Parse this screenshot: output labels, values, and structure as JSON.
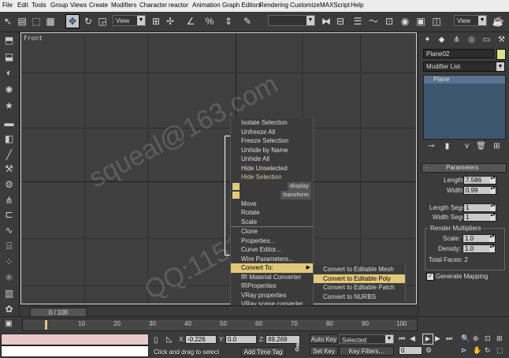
{
  "menubar": {
    "items": [
      "File",
      "Edit",
      "Tools",
      "Group",
      "Views",
      "Create",
      "Modifiers",
      "Character",
      "reactor",
      "Animation",
      "Graph Editors",
      "Rendering",
      "Customize",
      "MAXScript",
      "Help"
    ]
  },
  "toolbar": {
    "view_select_1": "View",
    "view_select_2": "View"
  },
  "viewport": {
    "label": "Front",
    "watermark_1": "squeal@163.com",
    "watermark_2": "QQ:11516493"
  },
  "quad_menu": {
    "top_items": [
      "Isolate Selection",
      "Unfreeze All",
      "Freeze Selection",
      "Unhide by Name",
      "Unhide All",
      "Hide Unselected",
      "Hide Selection"
    ],
    "display_label": "display",
    "transform_label": "transform",
    "transform_items": [
      "Move",
      "Rotate",
      "Scale",
      "Clone",
      "Properties...",
      "Curve Editor...",
      "Wire Parameters...",
      "Convert To:",
      "fR Material Converter",
      "fRProperties",
      "VRay properties",
      "VRay scene converter"
    ]
  },
  "submenu": {
    "items": [
      "Convert to Editable Mesh",
      "Convert to Editable Poly",
      "Convert to Editable Patch",
      "Convert to NURBS"
    ],
    "highlighted": "Convert to Editable Poly"
  },
  "command_panel": {
    "object_name": "Plane02",
    "object_color": "#d8e08a",
    "modifier_list": "Modifier List",
    "stack_item": "Plane",
    "rollout_title": "Parameters",
    "length_label": "Length:",
    "length_value": "7.586",
    "width_label": "Width:",
    "width_value": "0.99",
    "length_segs_label": "Length Segs:",
    "length_segs_value": "1",
    "width_segs_label": "Width Segs:",
    "width_segs_value": "1",
    "render_mult_title": "Render Multipliers",
    "scale_label": "Scale:",
    "scale_value": "1.0",
    "density_label": "Density:",
    "density_value": "1.0",
    "total_faces_label": "Total Faces: 2",
    "generate_mapping_label": "Generate Mapping",
    "generate_mapping_checked": true
  },
  "timeline": {
    "frame_counter": "0 / 100",
    "tick_labels": [
      "10",
      "20",
      "30",
      "40",
      "50",
      "60",
      "70",
      "80",
      "90",
      "100"
    ]
  },
  "status": {
    "x_label": "X:",
    "x_value": "-0.226",
    "y_label": "Y:",
    "y_value": "0.0",
    "z_label": "Z:",
    "z_value": "89.269",
    "auto_key": "Auto Key",
    "selected": "Selected",
    "set_key": "Set Key",
    "key_filters": "Key Filters...",
    "prompt": "Click and drag to select",
    "add_time_tag": "Add Time Tag",
    "frame_value": "0"
  },
  "colors": {
    "highlight": "#e1c979",
    "background": "#3b3b3b",
    "viewport_bg": "#3f3f3f"
  }
}
